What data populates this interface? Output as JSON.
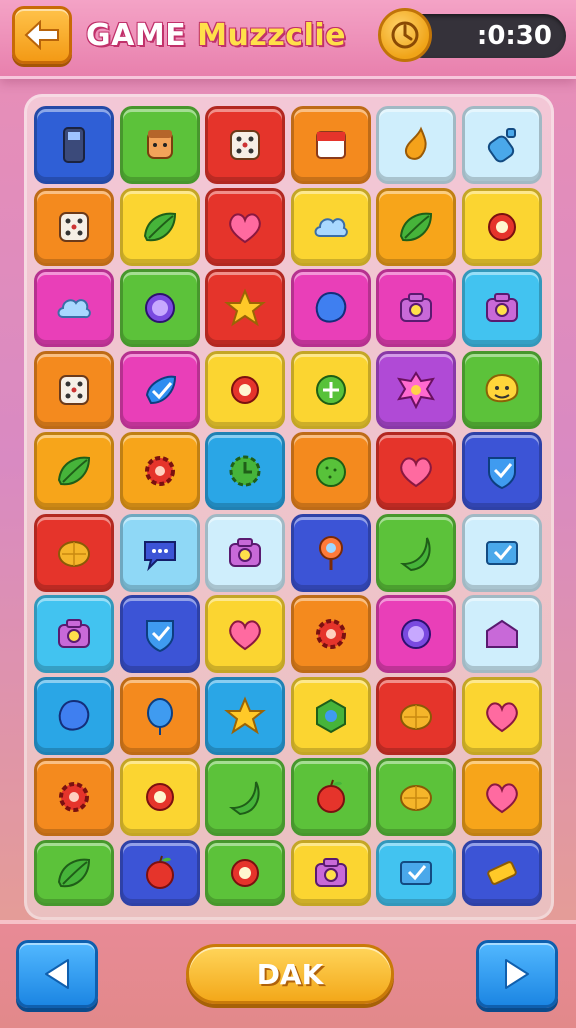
{
  "header": {
    "title_word1": "GAME",
    "title_word2": "Muzzclie",
    "timer": ":0:30",
    "back_icon": "arrow-left-icon",
    "clock_icon": "clock-icon"
  },
  "board": {
    "rows": [
      [
        {
          "color": "#2f5fd6",
          "icon": "phone"
        },
        {
          "color": "#5cc23a",
          "icon": "face"
        },
        {
          "color": "#e5342b",
          "icon": "dice"
        },
        {
          "color": "#f48a1e",
          "icon": "calendar"
        },
        {
          "color": "#cfeefc",
          "icon": "drop"
        },
        {
          "color": "#cfeefc",
          "icon": "bottle"
        }
      ],
      [
        {
          "color": "#f48a1e",
          "icon": "dice"
        },
        {
          "color": "#fbd531",
          "icon": "leaf"
        },
        {
          "color": "#e5342b",
          "icon": "heart"
        },
        {
          "color": "#fbd531",
          "icon": "cloud"
        },
        {
          "color": "#f7a51a",
          "icon": "leaf"
        },
        {
          "color": "#fbd531",
          "icon": "ring"
        }
      ],
      [
        {
          "color": "#e93fb8",
          "icon": "cloud"
        },
        {
          "color": "#5cc23a",
          "icon": "orb"
        },
        {
          "color": "#e5342b",
          "icon": "star"
        },
        {
          "color": "#e93fb8",
          "icon": "blob"
        },
        {
          "color": "#e93fb8",
          "icon": "camera"
        },
        {
          "color": "#42c3f0",
          "icon": "camera"
        }
      ],
      [
        {
          "color": "#f48a1e",
          "icon": "dice"
        },
        {
          "color": "#e93fb8",
          "icon": "check"
        },
        {
          "color": "#fbd531",
          "icon": "ring"
        },
        {
          "color": "#fbd531",
          "icon": "plus"
        },
        {
          "color": "#b04ad6",
          "icon": "splat"
        },
        {
          "color": "#5cc23a",
          "icon": "smile"
        }
      ],
      [
        {
          "color": "#f7a51a",
          "icon": "leaf"
        },
        {
          "color": "#f7a51a",
          "icon": "gear"
        },
        {
          "color": "#2aa6e6",
          "icon": "clock"
        },
        {
          "color": "#f48a1e",
          "icon": "lime"
        },
        {
          "color": "#e5342b",
          "icon": "heart"
        },
        {
          "color": "#3c54d6",
          "icon": "shield"
        }
      ],
      [
        {
          "color": "#e5342b",
          "icon": "lemon"
        },
        {
          "color": "#8fd8f6",
          "icon": "chat"
        },
        {
          "color": "#cfeefc",
          "icon": "camera"
        },
        {
          "color": "#3c54d6",
          "icon": "pin"
        },
        {
          "color": "#5cc23a",
          "icon": "banana"
        },
        {
          "color": "#cfeefc",
          "icon": "mail"
        }
      ],
      [
        {
          "color": "#42c3f0",
          "icon": "camera"
        },
        {
          "color": "#3c54d6",
          "icon": "shield"
        },
        {
          "color": "#fbd531",
          "icon": "heart"
        },
        {
          "color": "#f48a1e",
          "icon": "gear"
        },
        {
          "color": "#e93fb8",
          "icon": "orb"
        },
        {
          "color": "#cfeefc",
          "icon": "house"
        }
      ],
      [
        {
          "color": "#2aa6e6",
          "icon": "blob"
        },
        {
          "color": "#f48a1e",
          "icon": "balloon"
        },
        {
          "color": "#2aa6e6",
          "icon": "star"
        },
        {
          "color": "#fbd531",
          "icon": "hexagon"
        },
        {
          "color": "#e5342b",
          "icon": "lemon"
        },
        {
          "color": "#fbd531",
          "icon": "heart"
        }
      ],
      [
        {
          "color": "#f48a1e",
          "icon": "gear"
        },
        {
          "color": "#fbd531",
          "icon": "ring"
        },
        {
          "color": "#5cc23a",
          "icon": "banana"
        },
        {
          "color": "#5cc23a",
          "icon": "apple"
        },
        {
          "color": "#5cc23a",
          "icon": "lemon"
        },
        {
          "color": "#f7a51a",
          "icon": "heart"
        }
      ],
      [
        {
          "color": "#5cc23a",
          "icon": "leaf"
        },
        {
          "color": "#3c54d6",
          "icon": "apple"
        },
        {
          "color": "#5cc23a",
          "icon": "ring"
        },
        {
          "color": "#fbd531",
          "icon": "camera"
        },
        {
          "color": "#42c3f0",
          "icon": "mail"
        },
        {
          "color": "#3c54d6",
          "icon": "bar"
        }
      ]
    ]
  },
  "footer": {
    "prev_icon": "triangle-left-icon",
    "next_icon": "triangle-right-icon",
    "ok_label": "DAK"
  }
}
